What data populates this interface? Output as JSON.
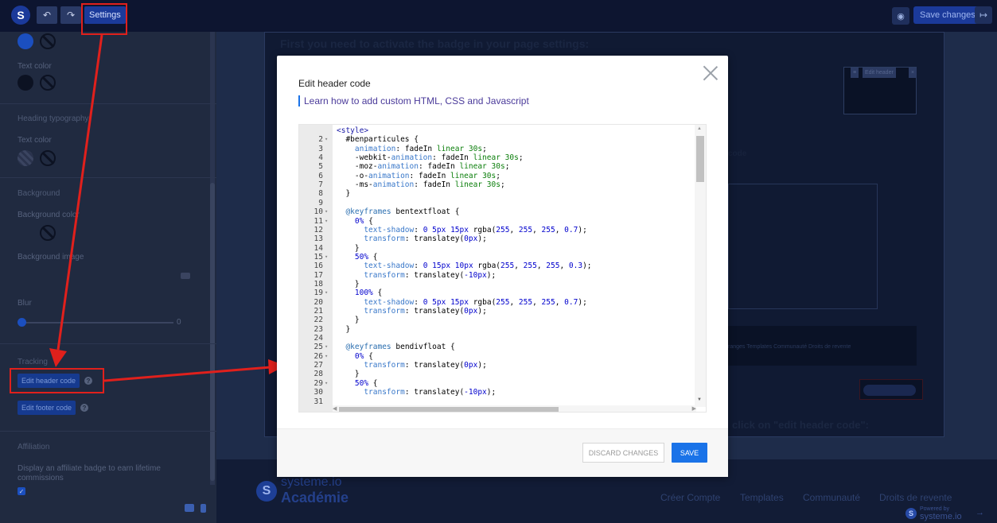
{
  "topbar": {
    "logo": "S",
    "undo_icon": "↶",
    "redo_icon": "↷",
    "settings_label": "Settings",
    "save_label": "Save changes",
    "eye_icon": "◉",
    "exit_icon": "↦"
  },
  "sidebar": {
    "text_color_label": "Text color",
    "heading_typography": "Heading typography",
    "heading_text_color": "Text color",
    "background_heading": "Background",
    "background_color_label": "Background color",
    "background_image_label": "Background image",
    "blur_label": "Blur",
    "blur_value": "0",
    "tracking_heading": "Tracking",
    "edit_header_code": "Edit header code",
    "edit_footer_code": "Edit footer code",
    "affiliation_heading": "Affiliation",
    "affiliate_text": "Display an affiliate badge to earn lifetime commissions",
    "checkbox_mark": "✓",
    "help_mark": "?"
  },
  "canvas": {
    "page_title": "First you need to activate the badge in your page settings:",
    "mini_btn_1": "≡",
    "mini_btn_2": "Edit header",
    "mini_btn_3": "×",
    "code_word": "code",
    "navbar_items": "ranges    Templates    Communauté    Droits de revente",
    "click_text": "click on \"edit header code\":",
    "footer_logo": "S",
    "footer_brand_1": "systeme.io",
    "footer_brand_2": "Académie",
    "footer_link_1": "Créer Compte",
    "footer_link_2": "Templates",
    "footer_link_3": "Communauté",
    "footer_link_4": "Droits de revente",
    "powered_small": "Powered by",
    "powered_big": "systeme.io",
    "powered_arrow": "→"
  },
  "modal": {
    "title": "Edit header code",
    "learn_link": "Learn how to add custom HTML, CSS and Javascript",
    "discard_label": "DISCARD CHANGES",
    "save_label": "SAVE",
    "scroll_up": "▲",
    "scroll_down": "▼",
    "scroll_left": "◀",
    "scroll_right": "▶",
    "code_lines": [
      {
        "n": "",
        "f": "",
        "t": "<style>"
      },
      {
        "n": "2",
        "f": "▾",
        "t": "  #benparticules {"
      },
      {
        "n": "3",
        "f": "",
        "t": "    animation: fadeIn linear 30s;"
      },
      {
        "n": "4",
        "f": "",
        "t": "    -webkit-animation: fadeIn linear 30s;"
      },
      {
        "n": "5",
        "f": "",
        "t": "    -moz-animation: fadeIn linear 30s;"
      },
      {
        "n": "6",
        "f": "",
        "t": "    -o-animation: fadeIn linear 30s;"
      },
      {
        "n": "7",
        "f": "",
        "t": "    -ms-animation: fadeIn linear 30s;"
      },
      {
        "n": "8",
        "f": "",
        "t": "  }"
      },
      {
        "n": "9",
        "f": "",
        "t": ""
      },
      {
        "n": "10",
        "f": "▾",
        "t": "  @keyframes bentextfloat {"
      },
      {
        "n": "11",
        "f": "▾",
        "t": "    0% {"
      },
      {
        "n": "12",
        "f": "",
        "t": "      text-shadow: 0 5px 15px rgba(255, 255, 255, 0.7);"
      },
      {
        "n": "13",
        "f": "",
        "t": "      transform: translatey(0px);"
      },
      {
        "n": "14",
        "f": "",
        "t": "    }"
      },
      {
        "n": "15",
        "f": "▾",
        "t": "    50% {"
      },
      {
        "n": "16",
        "f": "",
        "t": "      text-shadow: 0 15px 10px rgba(255, 255, 255, 0.3);"
      },
      {
        "n": "17",
        "f": "",
        "t": "      transform: translatey(-10px);"
      },
      {
        "n": "18",
        "f": "",
        "t": "    }"
      },
      {
        "n": "19",
        "f": "▾",
        "t": "    100% {"
      },
      {
        "n": "20",
        "f": "",
        "t": "      text-shadow: 0 5px 15px rgba(255, 255, 255, 0.7);"
      },
      {
        "n": "21",
        "f": "",
        "t": "      transform: translatey(0px);"
      },
      {
        "n": "22",
        "f": "",
        "t": "    }"
      },
      {
        "n": "23",
        "f": "",
        "t": "  }"
      },
      {
        "n": "24",
        "f": "",
        "t": ""
      },
      {
        "n": "25",
        "f": "▾",
        "t": "  @keyframes bendivfloat {"
      },
      {
        "n": "26",
        "f": "▾",
        "t": "    0% {"
      },
      {
        "n": "27",
        "f": "",
        "t": "      transform: translatey(0px);"
      },
      {
        "n": "28",
        "f": "",
        "t": "    }"
      },
      {
        "n": "29",
        "f": "▾",
        "t": "    50% {"
      },
      {
        "n": "30",
        "f": "",
        "t": "      transform: translatey(-10px);"
      },
      {
        "n": "31",
        "f": "",
        "t": ""
      }
    ]
  },
  "colors": {
    "accent_blue": "#1a73e8",
    "annotation_red": "#e0201c",
    "app_dark": "#0d1530"
  }
}
